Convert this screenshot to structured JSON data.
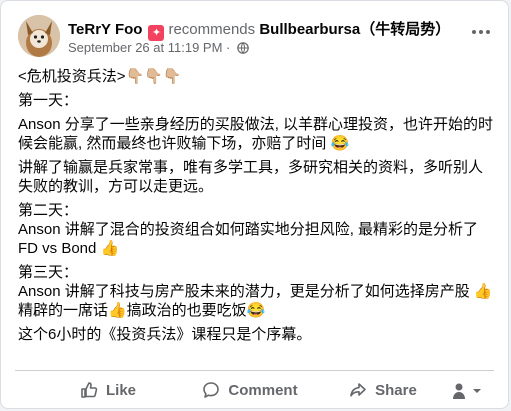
{
  "post": {
    "author": "TeRrY Foo",
    "badge": "✦",
    "verb": "recommends",
    "page_name": "Bullbearbursa（牛转局势）",
    "timestamp": "September 26 at 11:19 PM",
    "separator": "·",
    "lines": {
      "title": "<危机投资兵法>👇🏼👇🏼👇🏼",
      "day1_heading": "第一天：",
      "day1_p1": "Anson 分享了一些亲身经历的买股做法, 以羊群心理投资，也许开始的时候会能赢, 然而最终也许败输下场，亦赔了时间 😂",
      "day1_p2": "讲解了输赢是兵家常事，唯有多学工具，多研究相关的资料，多听别人失败的教训，方可以走更远。",
      "day2_heading": "第二天：",
      "day2_p1": "Anson 讲解了混合的投资组合如何踏实地分担风险, 最精彩的是分析了 FD vs Bond 👍",
      "day3_heading": "第三天：",
      "day3_p1": "Anson 讲解了科技与房产股未来的潜力，更是分析了如何选择房产股 👍 精辟的一席话👍搞政治的也要吃饭😂",
      "closing": "这个6小时的《投资兵法》课程只是个序幕。"
    }
  },
  "actions": {
    "like": "Like",
    "comment": "Comment",
    "share": "Share"
  },
  "colors": {
    "secondary_text": "#65676b",
    "badge": "#f3425f",
    "divider": "#ced0d4"
  }
}
